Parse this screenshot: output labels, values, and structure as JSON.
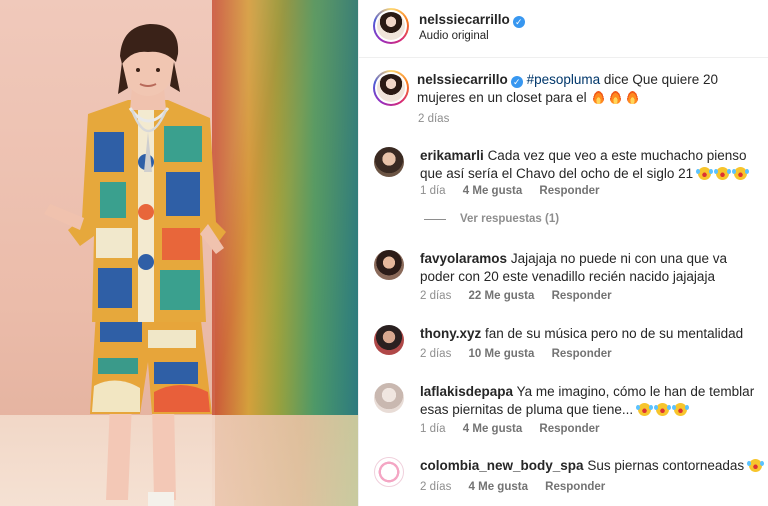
{
  "post": {
    "username": "nelssiecarrillo",
    "audio": "Audio original",
    "caption_hashtag": "#pesopluma",
    "caption_text": " dice Que quiere 20 mujeres en un closet para el",
    "caption_time": "2 días"
  },
  "comments": [
    {
      "username": "erikamarli",
      "text": "Cada vez que veo a este muchacho pienso que así sería el Chavo del ocho de el siglo 21",
      "time": "1 día",
      "likes": "4 Me gusta",
      "reply": "Responder"
    },
    {
      "username": "favyolaramos",
      "text": "Jajajaja no puede ni con una que va poder con 20 este venadillo recién nacido jajajaja",
      "time": "2 días",
      "likes": "22 Me gusta",
      "reply": "Responder"
    },
    {
      "username": "thony.xyz",
      "text": "fan de su música pero no de su mentalidad",
      "time": "2 días",
      "likes": "10 Me gusta",
      "reply": "Responder"
    },
    {
      "username": "laflakisdepapa",
      "text": "Ya me imagino, cómo le han de temblar esas piernitas de pluma que tiene...",
      "time": "1 día",
      "likes": "4 Me gusta",
      "reply": "Responder"
    },
    {
      "username": "colombia_new_body_spa",
      "text": "Sus piernas contorneadas",
      "time": "2 días",
      "likes": "4 Me gusta",
      "reply": "Responder"
    }
  ],
  "view_replies": "Ver respuestas (1)",
  "colors": {
    "link": "#00376b",
    "secondary_text": "#8e8e8e",
    "verified": "#3897f0"
  }
}
